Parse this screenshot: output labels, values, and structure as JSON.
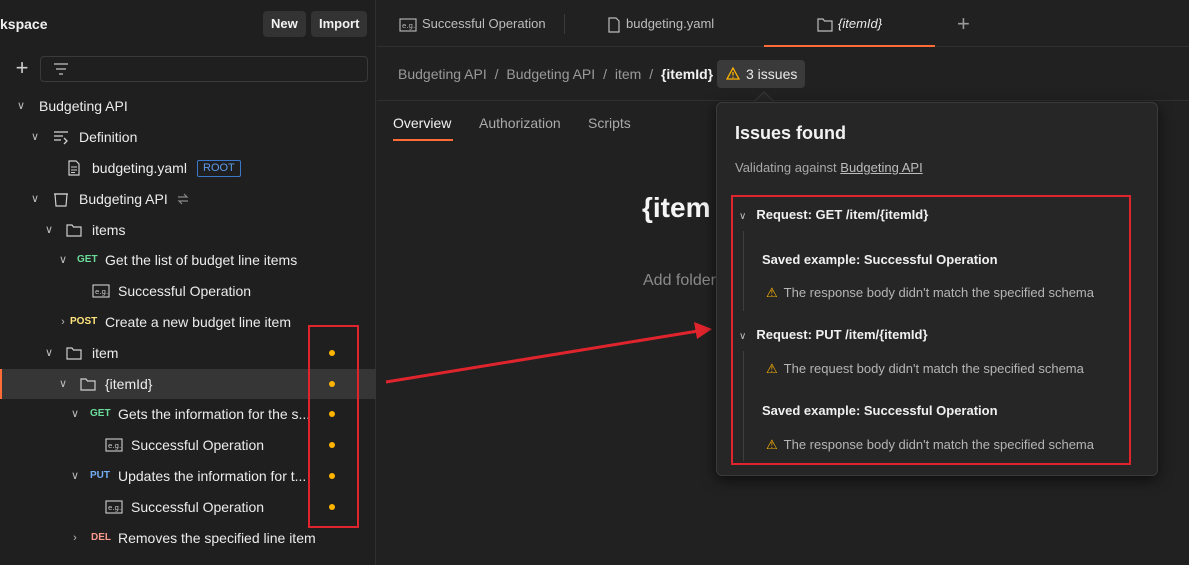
{
  "sidebar": {
    "workspace_title": "kspace",
    "new_label": "New",
    "import_label": "Import",
    "tree": {
      "api_root": "Budgeting API",
      "definition": "Definition",
      "yaml_file": "budgeting.yaml",
      "root_badge": "ROOT",
      "collection": "Budgeting API",
      "items_folder": "items",
      "get_list_method": "GET",
      "get_list_label": "Get the list of budget line items",
      "example1": "Successful Operation",
      "post_method": "POST",
      "post_label": "Create a new budget line item",
      "item_folder": "item",
      "itemid_folder": "{itemId}",
      "get_info_method": "GET",
      "get_info_label": "Gets the information for the s...",
      "example2": "Successful Operation",
      "put_method": "PUT",
      "put_label": "Updates the information for t...",
      "example3": "Successful Operation",
      "del_method": "DEL",
      "del_label": "Removes the specified line item"
    }
  },
  "tabs": [
    {
      "label": "Successful Operation"
    },
    {
      "label": "budgeting.yaml"
    },
    {
      "label": "{itemId}"
    }
  ],
  "breadcrumb": {
    "items": [
      "Budgeting API",
      "/",
      "Budgeting API",
      "/",
      "item",
      "/"
    ],
    "current": "{itemId}"
  },
  "issues_button": "3 issues",
  "subtabs": [
    "Overview",
    "Authorization",
    "Scripts"
  ],
  "main": {
    "title": "{item",
    "description_placeholder": "Add folder"
  },
  "issues_panel": {
    "title": "Issues found",
    "subtitle_prefix": "Validating against ",
    "subtitle_link": "Budgeting API",
    "request1": "Request: GET /item/{itemId}",
    "request1_example": "Saved example: Successful Operation",
    "request1_msg": "The response body didn't match the specified schema",
    "request2": "Request: PUT /item/{itemId}",
    "request2_msg": "The request body didn't match the specified schema",
    "request2_example": "Saved example: Successful Operation",
    "request2_example_msg": "The response body didn't match the specified schema"
  },
  "colors": {
    "accent": "#ff6c37",
    "warning": "#ffb400",
    "annotation_red": "#e0242d"
  }
}
